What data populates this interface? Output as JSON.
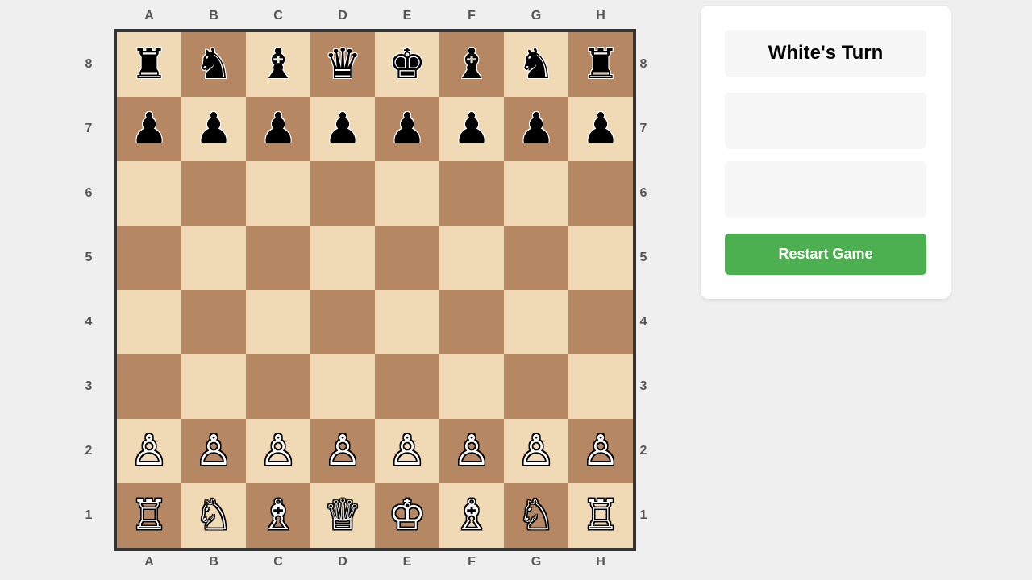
{
  "board": {
    "files": [
      "A",
      "B",
      "C",
      "D",
      "E",
      "F",
      "G",
      "H"
    ],
    "ranks": [
      "8",
      "7",
      "6",
      "5",
      "4",
      "3",
      "2",
      "1"
    ],
    "light_color": "#f0d9b5",
    "dark_color": "#b58863",
    "position": [
      [
        "br",
        "bn",
        "bb",
        "bq",
        "bk",
        "bb",
        "bn",
        "br"
      ],
      [
        "bp",
        "bp",
        "bp",
        "bp",
        "bp",
        "bp",
        "bp",
        "bp"
      ],
      [
        "",
        "",
        "",
        "",
        "",
        "",
        "",
        ""
      ],
      [
        "",
        "",
        "",
        "",
        "",
        "",
        "",
        ""
      ],
      [
        "",
        "",
        "",
        "",
        "",
        "",
        "",
        ""
      ],
      [
        "",
        "",
        "",
        "",
        "",
        "",
        "",
        ""
      ],
      [
        "wp",
        "wp",
        "wp",
        "wp",
        "wp",
        "wp",
        "wp",
        "wp"
      ],
      [
        "wr",
        "wn",
        "wb",
        "wq",
        "wk",
        "wb",
        "wn",
        "wr"
      ]
    ],
    "piece_icons": {
      "k": "king-icon",
      "q": "queen-icon",
      "r": "rook-icon",
      "b": "bishop-icon",
      "n": "knight-icon",
      "p": "pawn-icon"
    }
  },
  "panel": {
    "turn_text": "White's Turn",
    "status_text": "",
    "info_text": "",
    "restart_label": "Restart Game",
    "restart_color": "#4caf50"
  }
}
